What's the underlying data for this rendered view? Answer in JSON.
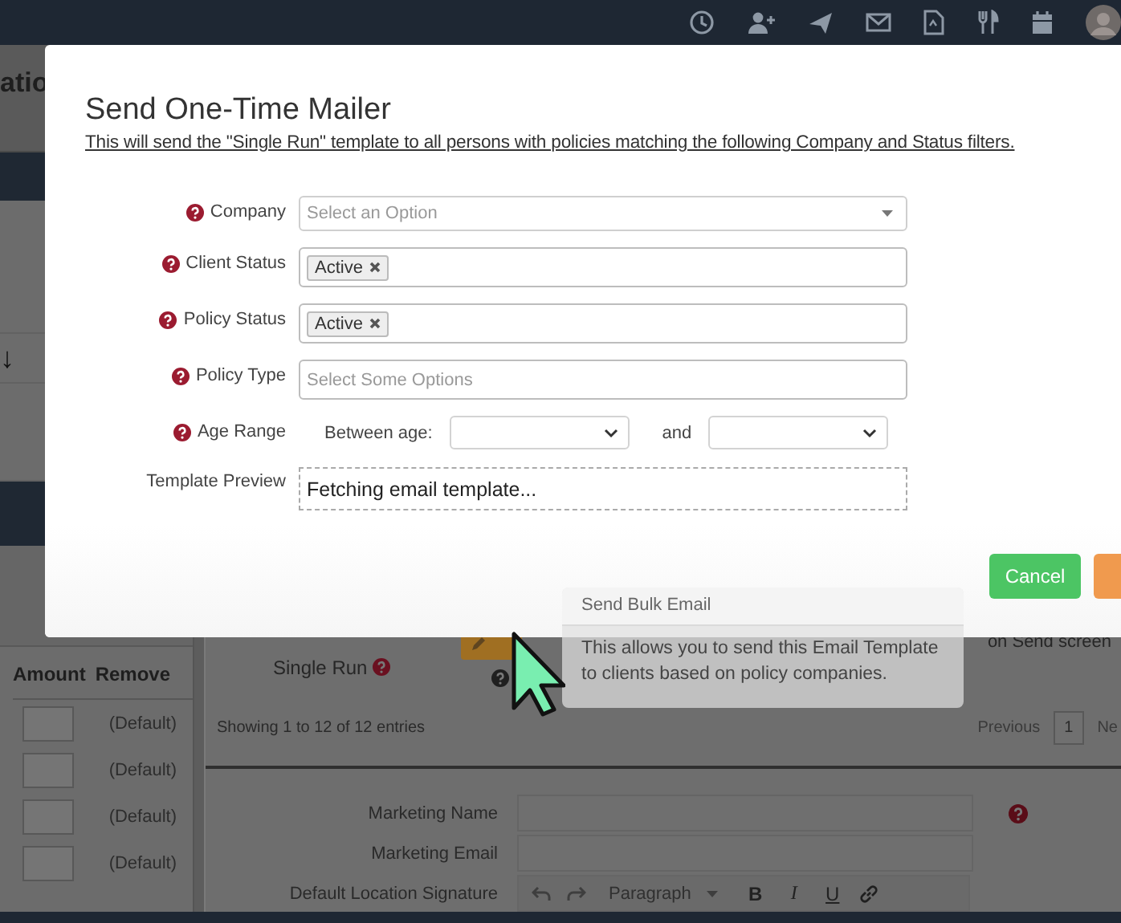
{
  "background": {
    "left_panel": {
      "heading": "atio",
      "sort_arrow": "↓",
      "columns": [
        "Amount",
        "Remove"
      ],
      "rows": [
        "(Default)",
        "(Default)",
        "(Default)",
        "(Default)"
      ]
    },
    "right_panel": {
      "single_run_label": "Single Run",
      "hint_text": "on Send screen",
      "entries_info": "Showing 1 to 12 of 12 entries",
      "pagination": {
        "previous": "Previous",
        "pages": [
          {
            "label": "1",
            "selected": true
          }
        ],
        "next": "Ne"
      },
      "form_fields": [
        {
          "label": "Marketing Name"
        },
        {
          "label": "Marketing Email"
        },
        {
          "label": "Default Location Signature"
        }
      ],
      "editor_toolbar": {
        "block_format": "Paragraph",
        "format_buttons": [
          "B",
          "I",
          "U"
        ]
      }
    }
  },
  "modal": {
    "title": "Send One-Time Mailer",
    "subtitle": "This will send the \"Single Run\" template to all persons with policies matching the following Company and Status filters.",
    "fields": [
      {
        "kind": "select",
        "label": "Company",
        "help": true,
        "placeholder": "Select an Option"
      },
      {
        "kind": "tags",
        "label": "Client Status",
        "help": true,
        "tags": [
          "Active"
        ]
      },
      {
        "kind": "tags",
        "label": "Policy Status",
        "help": true,
        "tags": [
          "Active"
        ]
      },
      {
        "kind": "tags",
        "label": "Policy Type",
        "help": true,
        "placeholder": "Select Some Options"
      },
      {
        "kind": "range",
        "label": "Age Range",
        "help": true,
        "prefix": "Between age:",
        "joiner": "and"
      },
      {
        "kind": "preview",
        "label": "Template Preview",
        "help": false,
        "value": "Fetching email template..."
      }
    ],
    "buttons": [
      {
        "kind": "cancel",
        "label": "Cancel"
      },
      {
        "kind": "confirm"
      }
    ]
  },
  "tooltip": {
    "title": "Send Bulk Email",
    "body": "This allows you to send this Email Template to clients based on policy companies."
  }
}
